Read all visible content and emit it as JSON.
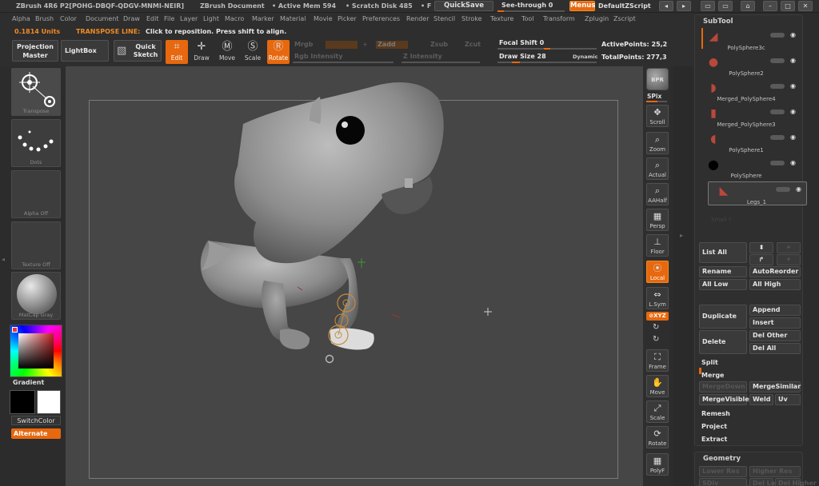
{
  "titlebar": {
    "app": "ZBrush 4R6 P2[POHG-DBQF-QDGV-MNMI-NEIR]",
    "document": "ZBrush Document",
    "active_mem": "• Active Mem 594",
    "scratch_disk": "• Scratch Disk 485",
    "extra": "• F",
    "quicksave": "QuickSave",
    "see_through": "See-through  0",
    "menus": "Menus",
    "default_script": "DefaultZScript"
  },
  "menu": [
    "Alpha",
    "Brush",
    "Color",
    "Document",
    "Draw",
    "Edit",
    "File",
    "Layer",
    "Light",
    "Macro",
    "Marker",
    "Material",
    "Movie",
    "Picker",
    "Preferences",
    "Render",
    "Stencil",
    "Stroke",
    "Texture",
    "Tool",
    "Transform",
    "Zplugin",
    "Zscript"
  ],
  "status": {
    "units": "0.1814 Units",
    "transpose": "TRANSPOSE LINE:",
    "message": "Click to reposition. Press shift to align."
  },
  "toolbar": {
    "projection_master": "Projection Master",
    "lightbox": "LightBox",
    "quick_sketch": "Quick Sketch",
    "edit": "Edit",
    "draw": "Draw",
    "move": "Move",
    "scale": "Scale",
    "rotate": "Rotate",
    "mrgb": "Mrgb",
    "zadd": "Zadd",
    "zsub": "Zsub",
    "zcut": "Zcut",
    "rgb_intensity": "Rgb Intensity",
    "z_intensity": "Z Intensity",
    "focal_shift": "Focal Shift 0",
    "draw_size": "Draw Size 28",
    "dynamic": "Dynamic",
    "active_points": "ActivePoints: 25,2",
    "total_points": "TotalPoints: 277,3"
  },
  "left": {
    "brush": "Transpose",
    "stroke": "Dots",
    "alpha": "Alpha Off",
    "texture": "Texture Off",
    "material": "MatCap Gray",
    "gradient": "Gradient",
    "switch_color": "SwitchColor",
    "alternate": "Alternate"
  },
  "right": {
    "bpr": "BPR",
    "spix": "SPix",
    "scroll": "Scroll",
    "zoom": "Zoom",
    "actual": "Actual",
    "aahalf": "AAHalf",
    "persp": "Persp",
    "floor": "Floor",
    "local": "Local",
    "lsym": "L.Sym",
    "xyz": "XYZ",
    "frame": "Frame",
    "move": "Move",
    "scale": "Scale",
    "rotate": "Rotate",
    "polyf": "PolyF"
  },
  "subtool": {
    "title": "SubTool",
    "items": [
      "PolySphere3c",
      "PolySphere2",
      "Merged_PolySphere4",
      "Merged_PolySphere3",
      "PolySphere1",
      "PolySphere",
      "Legs_1"
    ],
    "list_all": "List All",
    "rename": "Rename",
    "auto_reorder": "AutoReorder",
    "all_low": "All Low",
    "all_high": "All High",
    "duplicate": "Duplicate",
    "append": "Append",
    "insert": "Insert",
    "del_other": "Del Other",
    "delete": "Delete",
    "del_all": "Del All",
    "split": "Split",
    "merge": "Merge",
    "merge_down": "MergeDown",
    "merge_similar": "MergeSimilar",
    "merge_visible": "MergeVisible",
    "weld": "Weld",
    "uv": "Uv",
    "remesh": "Remesh",
    "project": "Project",
    "extract": "Extract",
    "geometry": "Geometry",
    "lower_res": "Lower Res",
    "higher_res": "Higher Res",
    "sdiv": "SDiv",
    "del_lower": "Del Lower",
    "del_higher": "Del Higher"
  }
}
